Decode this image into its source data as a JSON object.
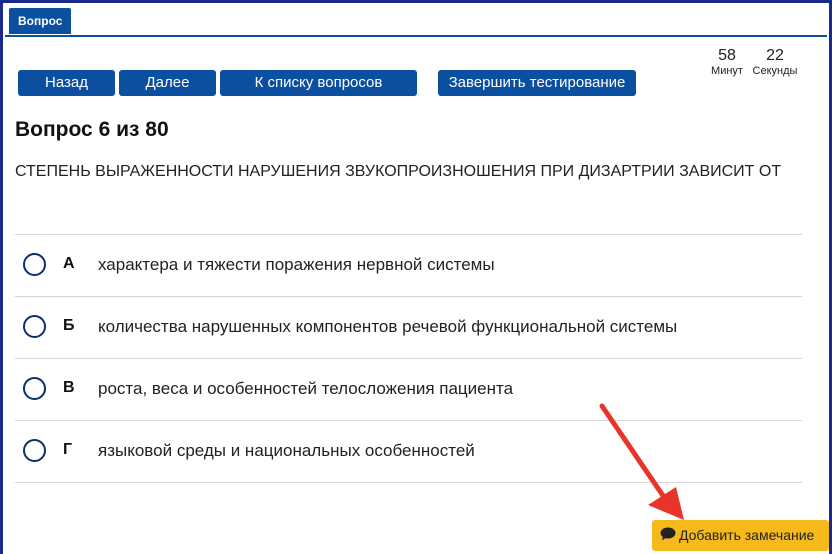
{
  "tab": {
    "label": "Вопрос"
  },
  "nav": {
    "back": "Назад",
    "next": "Далее",
    "list": "К списку вопросов",
    "finish": "Завершить тестирование"
  },
  "timer": {
    "minutes": "58",
    "minutes_label": "Минут",
    "seconds": "22",
    "seconds_label": "Секунды"
  },
  "question": {
    "title": "Вопрос 6 из 80",
    "text": "СТЕПЕНЬ ВЫРАЖЕННОСТИ НАРУШЕНИЯ ЗВУКОПРОИЗНОШЕНИЯ ПРИ ДИЗАРТРИИ ЗАВИСИТ ОТ"
  },
  "answers": [
    {
      "letter": "А",
      "text": "характера и тяжести поражения нервной системы"
    },
    {
      "letter": "Б",
      "text": "количества нарушенных компонентов речевой функциональной системы"
    },
    {
      "letter": "В",
      "text": "роста, веса и особенностей телосложения пациента"
    },
    {
      "letter": "Г",
      "text": "языковой среды и национальных особенностей"
    }
  ],
  "note": {
    "label": "Добавить замечание",
    "icon": "comment-icon"
  },
  "colors": {
    "primary": "#0a4fa0",
    "frame": "#1a2a8a",
    "note": "#f6b91b",
    "arrow": "#e8352b"
  }
}
